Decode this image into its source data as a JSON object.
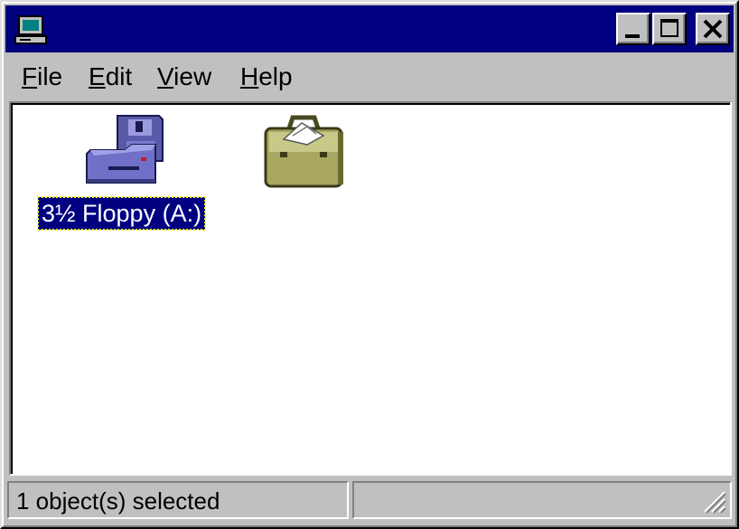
{
  "window": {
    "title": "",
    "icon": "computer-icon",
    "buttons": {
      "minimize": "minimize-icon",
      "maximize": "maximize-icon",
      "close": "close-icon"
    }
  },
  "menu": {
    "items": [
      {
        "mnemonic": "F",
        "rest": "ile"
      },
      {
        "mnemonic": "E",
        "rest": "dit"
      },
      {
        "mnemonic": "V",
        "rest": "iew"
      },
      {
        "mnemonic": "H",
        "rest": "elp"
      }
    ]
  },
  "content": {
    "icons": [
      {
        "label": "3½ Floppy (A:)",
        "icon": "floppy-drive-icon",
        "selected": true
      },
      {
        "label": "",
        "icon": "briefcase-icon",
        "selected": false
      }
    ]
  },
  "status": {
    "text": "1 object(s) selected",
    "right": ""
  },
  "colors": {
    "titlebar": "#000080",
    "face": "#c0c0c0",
    "selection": "#000080",
    "content_bg": "#ffffff"
  }
}
